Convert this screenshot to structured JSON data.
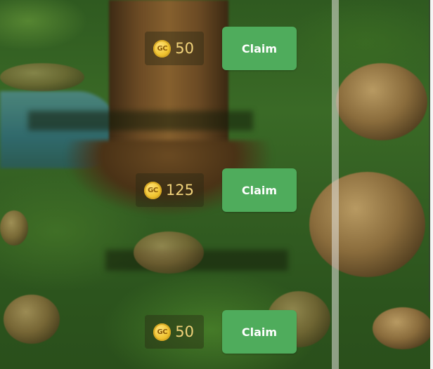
{
  "rewards": [
    {
      "currency_icon": "gold-coin-icon",
      "currency_code": "GC",
      "amount": "50",
      "claim_label": "Claim"
    },
    {
      "currency_icon": "gold-coin-icon",
      "currency_code": "GC",
      "amount": "125",
      "claim_label": "Claim"
    },
    {
      "currency_icon": "gold-coin-icon",
      "currency_code": "GC",
      "amount": "50",
      "claim_label": "Claim"
    }
  ],
  "colors": {
    "claim_button": "#4fac5c",
    "coin": "#f0c431",
    "amount_text": "#f0d27a"
  }
}
